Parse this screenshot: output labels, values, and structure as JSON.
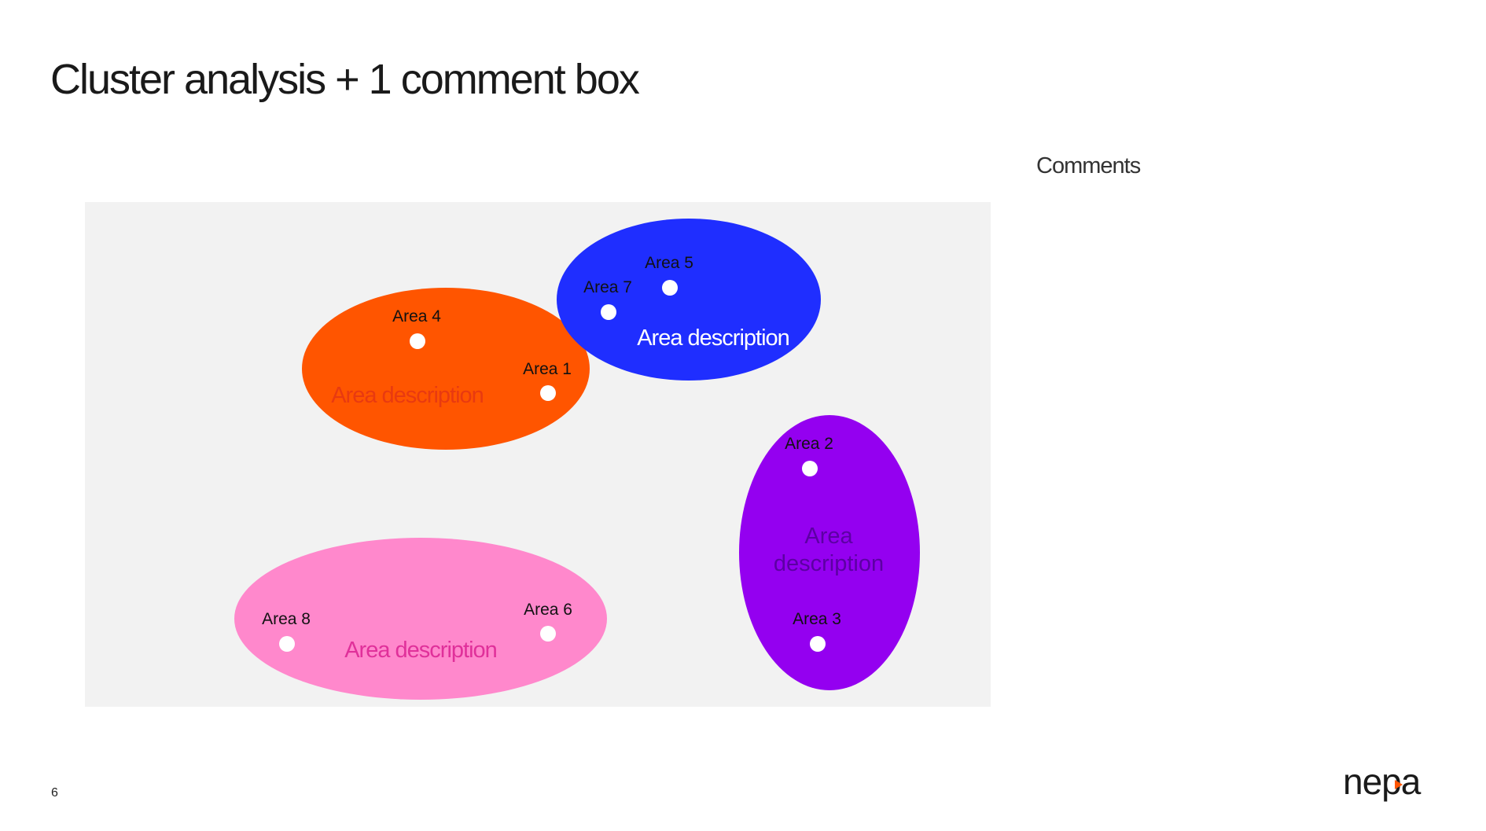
{
  "slide": {
    "title": "Cluster analysis + 1 comment box",
    "comments_label": "Comments",
    "page_number": "6",
    "logo_text": "nepa"
  },
  "clusters": [
    {
      "name": "orange-cluster",
      "color": "#ff5500",
      "description": "Area description",
      "description_color": "#e83a10",
      "points": [
        {
          "label": "Area 4"
        },
        {
          "label": "Area 1"
        }
      ]
    },
    {
      "name": "blue-cluster",
      "color": "#1f2eff",
      "description": "Area description",
      "description_color": "#ffffff",
      "points": [
        {
          "label": "Area 7"
        },
        {
          "label": "Area 5"
        }
      ]
    },
    {
      "name": "purple-cluster",
      "color": "#9400f0",
      "description_lines": [
        "Area",
        "description"
      ],
      "description_color": "#5c00a3",
      "points": [
        {
          "label": "Area 2"
        },
        {
          "label": "Area 3"
        }
      ]
    },
    {
      "name": "pink-cluster",
      "color": "#ff88cc",
      "description": "Area description",
      "description_color": "#e0309a",
      "points": [
        {
          "label": "Area 8"
        },
        {
          "label": "Area 6"
        }
      ]
    }
  ],
  "colors": {
    "panel_background": "#f2f2f2",
    "point": "#ffffff",
    "logo_accent": "#ff5500"
  }
}
